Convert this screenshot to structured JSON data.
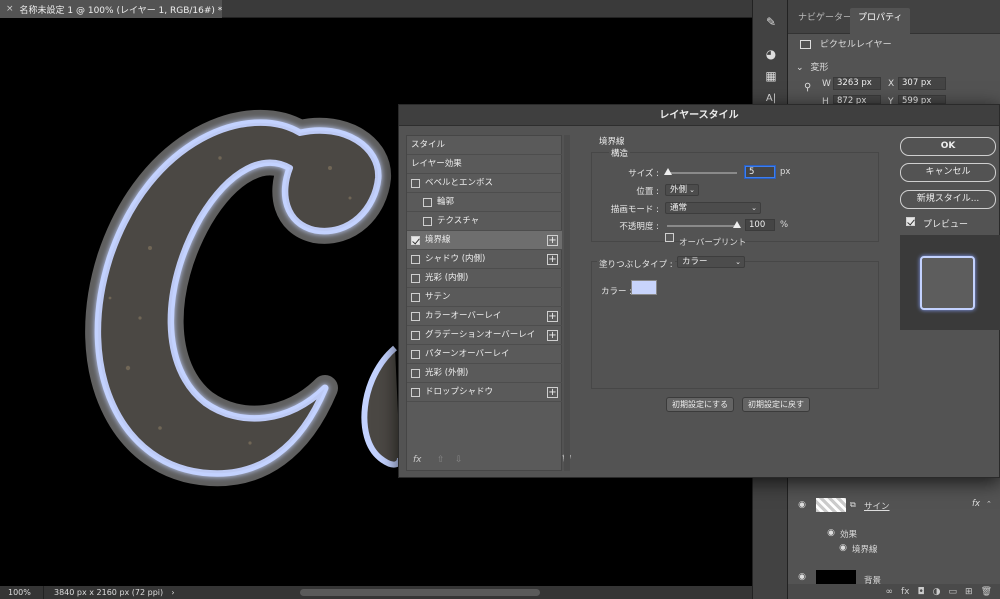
{
  "document": {
    "tab_close": "×",
    "tab_title": "名称未設定 1 @ 100% (レイヤー 1, RGB/16#) *",
    "zoom": "100%",
    "info": "3840 px x 2160 px (72 ppi)",
    "status_chevron": "›"
  },
  "panel": {
    "tabs": [
      "ナビゲーター",
      "プロパティ"
    ],
    "active_tab": 1,
    "layer_type": "ピクセルレイヤー",
    "section": "変形",
    "w_label": "W",
    "w_value": "3263 px",
    "x_label": "X",
    "x_value": "307 px",
    "h_label": "H",
    "h_value": "872 px",
    "y_label": "Y",
    "y_value": "599 px",
    "layers": {
      "sign_name": "サイン",
      "fx_badge": "fx",
      "effects_label": "効果",
      "stroke_effect": "境界線",
      "background_name": "背景"
    },
    "footer_icons": [
      "link-icon",
      "fx-icon",
      "mask-icon",
      "adjustment-icon",
      "folder-icon",
      "new-layer-icon",
      "trash-icon"
    ],
    "footer_glyphs": [
      "∞",
      "fx",
      "◘",
      "◑",
      "▭",
      "⊞",
      "🗑"
    ]
  },
  "dialog": {
    "title": "レイヤースタイル",
    "styles_header": "スタイル",
    "effects_header": "レイヤー効果",
    "items": [
      {
        "label": "ベベルとエンボス",
        "checked": false,
        "plus": false,
        "indent": 0
      },
      {
        "label": "輪郭",
        "checked": false,
        "plus": false,
        "indent": 1
      },
      {
        "label": "テクスチャ",
        "checked": false,
        "plus": false,
        "indent": 1
      },
      {
        "label": "境界線",
        "checked": true,
        "plus": true,
        "indent": 0,
        "selected": true
      },
      {
        "label": "シャドウ (内側)",
        "checked": false,
        "plus": true,
        "indent": 0
      },
      {
        "label": "光彩 (内側)",
        "checked": false,
        "plus": false,
        "indent": 0
      },
      {
        "label": "サテン",
        "checked": false,
        "plus": false,
        "indent": 0
      },
      {
        "label": "カラーオーバーレイ",
        "checked": false,
        "plus": true,
        "indent": 0
      },
      {
        "label": "グラデーションオーバーレイ",
        "checked": false,
        "plus": true,
        "indent": 0
      },
      {
        "label": "パターンオーバーレイ",
        "checked": false,
        "plus": false,
        "indent": 0
      },
      {
        "label": "光彩 (外側)",
        "checked": false,
        "plus": false,
        "indent": 0
      },
      {
        "label": "ドロップシャドウ",
        "checked": false,
        "plus": true,
        "indent": 0
      }
    ],
    "plus_glyph": "+",
    "footer": {
      "fx": "fx",
      "up": "⇧",
      "down": "⇩",
      "trash": "🗑"
    },
    "stroke": {
      "title": "境界線",
      "structure": "構造",
      "size_label": "サイズ :",
      "size_value": "5",
      "size_unit": "px",
      "size_slider": 0.02,
      "position_label": "位置 :",
      "position_value": "外側",
      "blend_label": "描画モード :",
      "blend_value": "通常",
      "opacity_label": "不透明度 :",
      "opacity_value": "100",
      "opacity_unit": "%",
      "opacity_slider": 1.0,
      "overprint_label": "オーバープリント",
      "overprint_checked": false,
      "fill_type_label": "塗りつぶしタイプ :",
      "fill_type_value": "カラー",
      "color_label": "カラー :",
      "color_value": "#c8d4fb",
      "reset_default": "初期設定にする",
      "restore_default": "初期設定に戻す"
    },
    "buttons": {
      "ok": "OK",
      "cancel": "キャンセル",
      "new_style": "新規スタイル...",
      "preview_label": "プレビュー",
      "preview_checked": true
    }
  },
  "colors": {
    "stroke_glow": "#c3d2ff",
    "accent_focus": "#3d7ef0"
  }
}
